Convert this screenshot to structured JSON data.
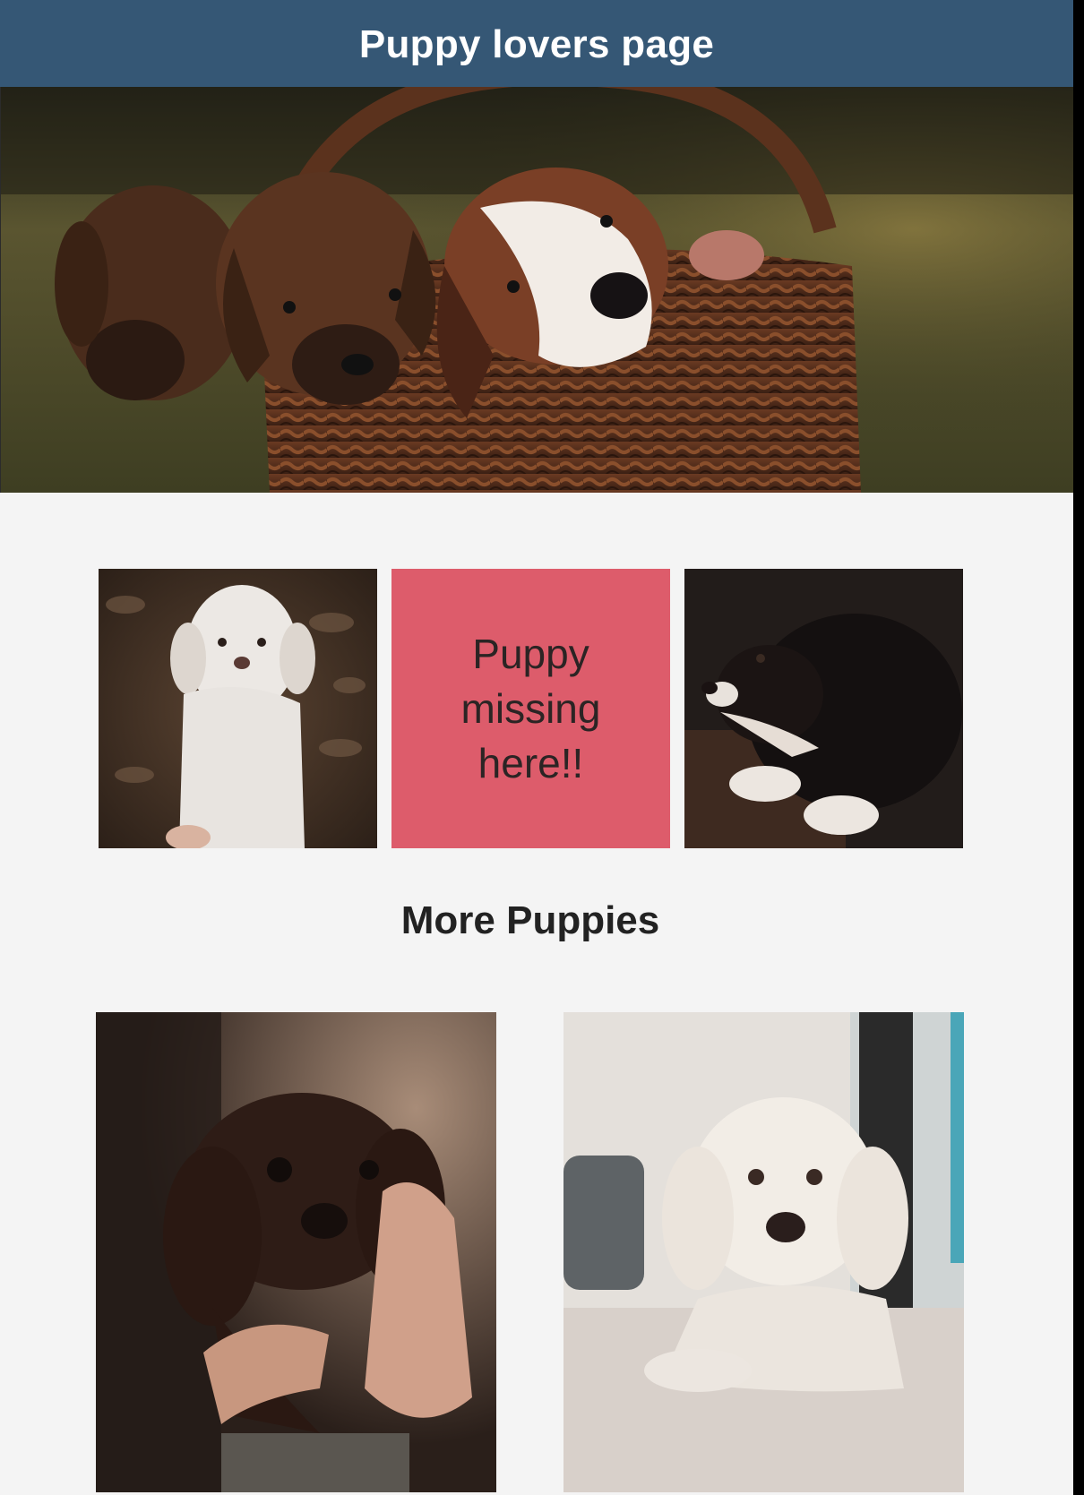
{
  "header": {
    "title": "Puppy lovers page"
  },
  "tiles": {
    "missing_text": "Puppy missing here!!"
  },
  "section": {
    "title": "More Puppies"
  },
  "colors": {
    "header_bg": "#355775",
    "missing_tile_bg": "#dd5c6b",
    "page_bg": "#f4f4f4"
  }
}
